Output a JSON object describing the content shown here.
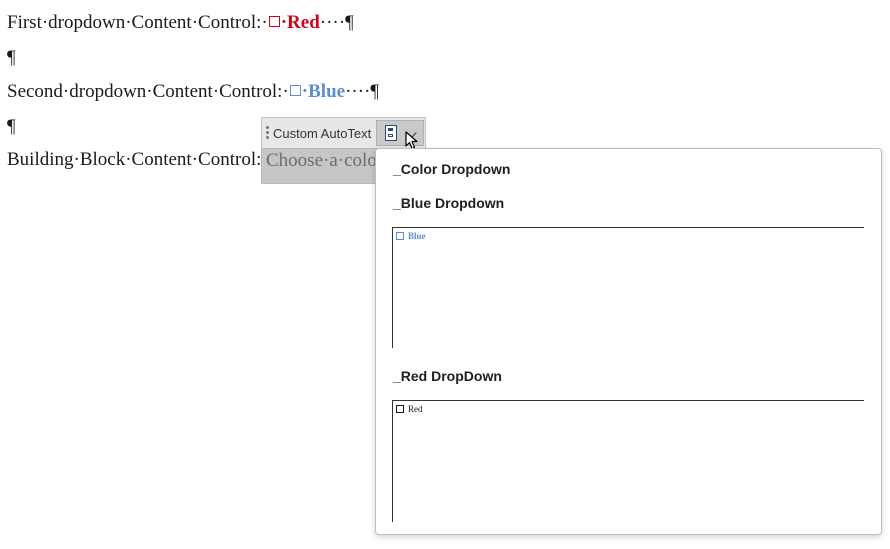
{
  "document": {
    "line1_label": "First·dropdown·Content·Control:·",
    "line1_value": "·Red",
    "line1_tail": "····¶",
    "para_mark": "¶",
    "line2_label": "Second·dropdown·Content·Control:·",
    "line2_value": "·Blue",
    "line2_tail": "····¶",
    "line4_label": "Building·Block·Content·Control:·"
  },
  "content_control": {
    "title": "Custom AutoText",
    "placeholder": "Choose·a·colo",
    "button_icon": "document-gallery-icon",
    "dropdown_icon": "chevron-down-icon"
  },
  "gallery": {
    "items": [
      {
        "label": "_Color Dropdown"
      },
      {
        "label": "_Blue Dropdown",
        "preview_text": "Blue"
      },
      {
        "label": "_Red DropDown",
        "preview_text": "Red"
      }
    ]
  },
  "colors": {
    "red": "#d0021b",
    "blue": "#5b8fd1"
  }
}
